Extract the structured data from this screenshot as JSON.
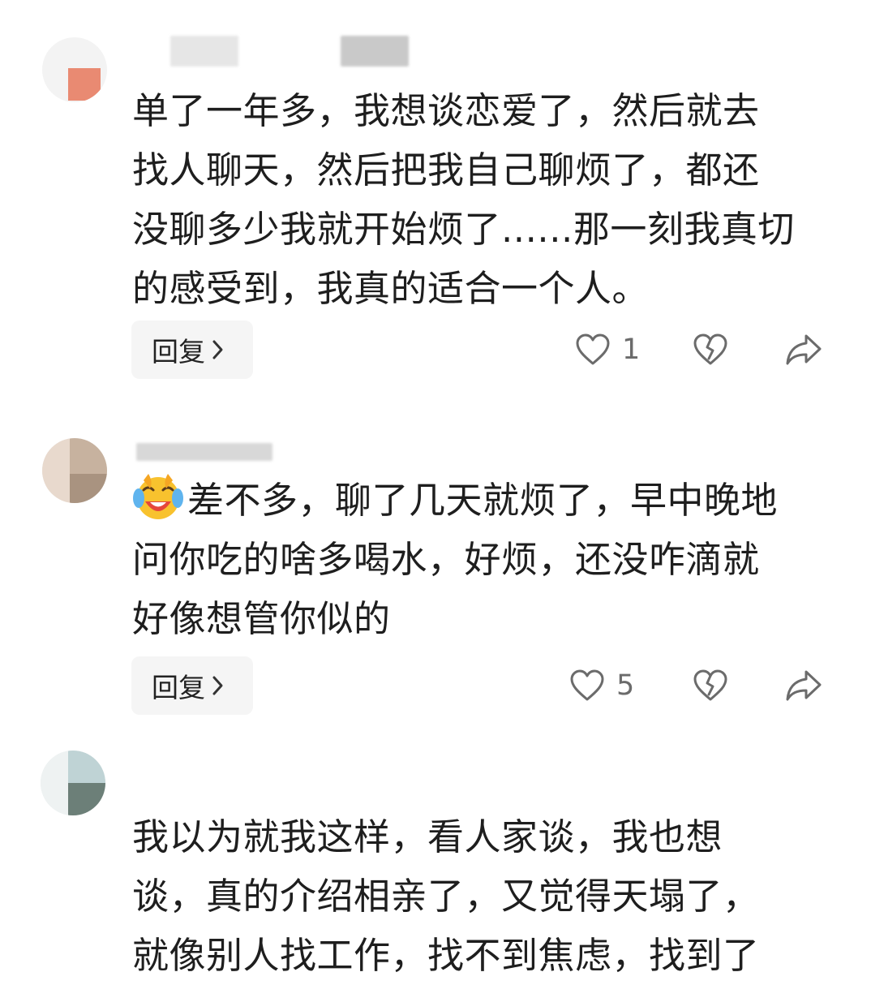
{
  "comments": [
    {
      "text": "单了一年多，我想谈恋爱了，然后就去\n找人聊天，然后把我自己聊烦了，都还\n没聊多少我就开始烦了......那一刻我真切\n的感受到，我真的适合一个人。",
      "reply_label": "回复",
      "like_count": "1"
    },
    {
      "emoji": "laughing-crying-emoji",
      "text": "差不多，聊了几天就烦了，早中晚地\n问你吃的啥多喝水，好烦，还没咋滴就\n好像想管你似的",
      "reply_label": "回复",
      "like_count": "5"
    },
    {
      "text": "我以为就我这样，看人家谈，我也想\n谈，真的介绍相亲了，又觉得天塌了，\n就像别人找工作，找不到焦虑，找到了"
    }
  ],
  "icons": {
    "like": "heart-outline-icon",
    "dislike": "broken-heart-icon",
    "share": "share-arrow-icon",
    "reply_chevron": "chevron-right-icon"
  },
  "colors": {
    "text": "#1e1e1e",
    "reply_bg": "#f5f5f5",
    "icon": "#6b6b6b"
  }
}
